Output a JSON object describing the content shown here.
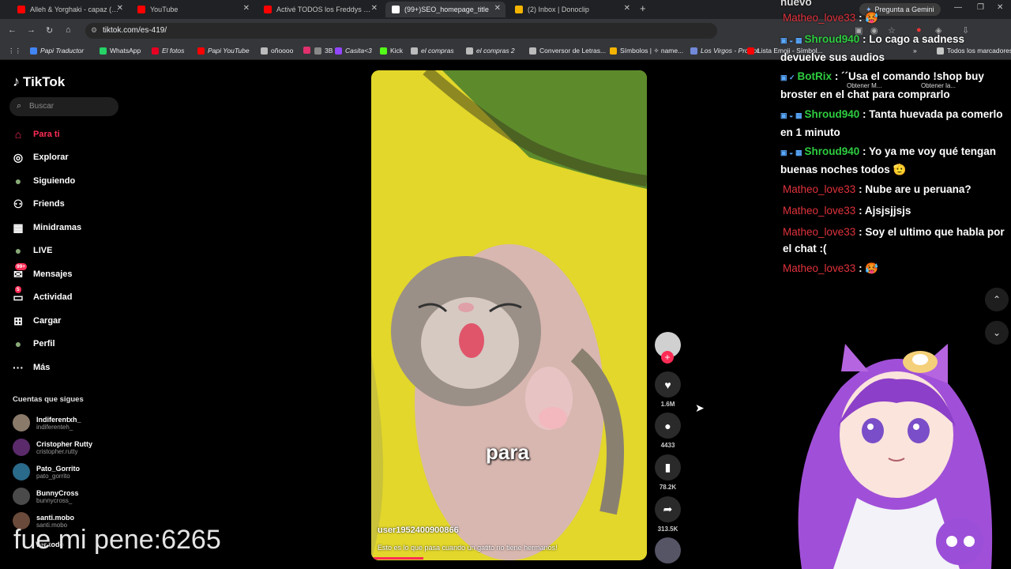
{
  "browser": {
    "tabs": [
      {
        "label": "Alleh & Yorghaki - capaz (mera",
        "color": "#ff0000"
      },
      {
        "label": "YouTube",
        "color": "#ff0000"
      },
      {
        "label": "Activé TODOS los Freddys en",
        "color": "#ff0000"
      },
      {
        "label": "(99+)SEO_homepage_title",
        "color": "#ffffff"
      },
      {
        "label": "(2) Inbox | Donoclip",
        "color": "#f4b400"
      }
    ],
    "gemini_label": "Pregunta a Gemini",
    "url": "tiktok.com/es-419/",
    "bookmarks": [
      {
        "label": "Papi Traductor",
        "italic": true,
        "color": "#4285f4"
      },
      {
        "label": "WhatsApp",
        "italic": false,
        "color": "#25d366"
      },
      {
        "label": "El fotos",
        "italic": true,
        "color": "#e60023"
      },
      {
        "label": "Papi YouTube",
        "italic": true,
        "color": "#ff0000"
      },
      {
        "label": "oñoooo",
        "italic": false,
        "color": "#bbbbbb"
      },
      {
        "label": "",
        "italic": false,
        "color": "#e1306c"
      },
      {
        "label": "3B",
        "italic": false,
        "color": "#888888"
      },
      {
        "label": "Casita<3",
        "italic": true,
        "color": "#9146ff"
      },
      {
        "label": "Kick",
        "italic": false,
        "color": "#53fc18"
      },
      {
        "label": "el compras",
        "italic": true,
        "color": "#bbbbbb"
      },
      {
        "label": "el compras 2",
        "italic": true,
        "color": "#bbbbbb"
      },
      {
        "label": "Conversor de Letras...",
        "italic": false,
        "color": "#bbbbbb"
      },
      {
        "label": "Símbolos | ✧ name...",
        "italic": false,
        "color": "#f4b400"
      },
      {
        "label": "Los Virgos - ProBot",
        "italic": true,
        "color": "#7289da"
      },
      {
        "label": "Lista Emoji - Símbol...",
        "italic": false,
        "color": "#ff0000"
      }
    ],
    "all_bookmarks": "Todos los marcadores"
  },
  "sidebar": {
    "logo": "TikTok",
    "search_placeholder": "Buscar",
    "nav": [
      {
        "label": "Para ti",
        "icon": "home-icon",
        "glyph": "⌂",
        "active": true,
        "badge": ""
      },
      {
        "label": "Explorar",
        "icon": "compass-icon",
        "glyph": "◎",
        "active": false,
        "badge": ""
      },
      {
        "label": "Siguiendo",
        "icon": "following-avatar-icon",
        "glyph": "●",
        "active": false,
        "badge": ""
      },
      {
        "label": "Friends",
        "icon": "friends-icon",
        "glyph": "⚇",
        "active": false,
        "badge": ""
      },
      {
        "label": "Minidramas",
        "icon": "minidramas-icon",
        "glyph": "▦",
        "active": false,
        "badge": ""
      },
      {
        "label": "LIVE",
        "icon": "live-avatar-icon",
        "glyph": "●",
        "active": false,
        "badge": ""
      },
      {
        "label": "Mensajes",
        "icon": "messages-icon",
        "glyph": "✉",
        "active": false,
        "badge": "99+"
      },
      {
        "label": "Actividad",
        "icon": "activity-icon",
        "glyph": "▭",
        "active": false,
        "badge": "5"
      },
      {
        "label": "Cargar",
        "icon": "upload-icon",
        "glyph": "⊞",
        "active": false,
        "badge": ""
      },
      {
        "label": "Perfil",
        "icon": "profile-avatar-icon",
        "glyph": "●",
        "active": false,
        "badge": ""
      },
      {
        "label": "Más",
        "icon": "more-icon",
        "glyph": "···",
        "active": false,
        "badge": ""
      }
    ],
    "following_title": "Cuentas que sigues",
    "following": [
      {
        "name": "Indiferentxh_",
        "handle": "indiferenteh_",
        "color": "#8a7a6a"
      },
      {
        "name": "Cristopher Rutty",
        "handle": "cristopher.rutty",
        "color": "#5a2a6a"
      },
      {
        "name": "Pato_Gorrito",
        "handle": "pato_gorrito",
        "color": "#2a6a8a"
      },
      {
        "name": "BunnyCross",
        "handle": "bunnycross_",
        "color": "#4a4a4a"
      },
      {
        "name": "santi.mobo",
        "handle": "santi.mobo",
        "color": "#6a4a3a"
      }
    ],
    "see_more": "Ver todo"
  },
  "overlay_text": "fue mi pene:6265",
  "video": {
    "caption": "para",
    "user": "user1952400900866",
    "description": "Esto es lo que pasa cuando un gatito no tiene hermanos!",
    "progress": 0.19
  },
  "actions": {
    "likes": "1.6M",
    "comments": "4433",
    "saves": "78.2K",
    "shares": "313.5K"
  },
  "chat": {
    "partial_top": "nuevo",
    "messages": [
      {
        "user": "Matheo_love33",
        "user_color": "#e0323c",
        "text": ": 🥵",
        "badges": ""
      },
      {
        "user": "Shroud940",
        "user_color": "#2ecc40",
        "text": ": Lo cago a sadness devuelve sus audios",
        "badges": "▣ ◒ ▦"
      },
      {
        "user": "BotRix",
        "user_color": "#2ecc40",
        "text": ": ´´Usa el comando !shop buy broster en el chat para comprarlo",
        "badges": "▣ ✓"
      },
      {
        "user": "Shroud940",
        "user_color": "#2ecc40",
        "text": ": Tanta huevada pa comerlo en 1 minuto",
        "badges": "▣ ◒ ▦"
      },
      {
        "user": "Shroud940",
        "user_color": "#2ecc40",
        "text": ": Yo ya me voy qué tengan buenas noches todos 🫡",
        "badges": "▣ ◒ ▦"
      },
      {
        "user": "Matheo_love33",
        "user_color": "#e0323c",
        "text": ": Nube are u peruana?",
        "badges": ""
      },
      {
        "user": "Matheo_love33",
        "user_color": "#e0323c",
        "text": ": Ajsjsjjsjs",
        "badges": ""
      },
      {
        "user": "Matheo_love33",
        "user_color": "#e0323c",
        "text": ": Soy el ultimo que habla por el chat :(",
        "badges": ""
      },
      {
        "user": "Matheo_love33",
        "user_color": "#e0323c",
        "text": ": 🥵",
        "badges": ""
      }
    ],
    "extension_hints": [
      "Obtener M...",
      "Obtener la..."
    ]
  }
}
